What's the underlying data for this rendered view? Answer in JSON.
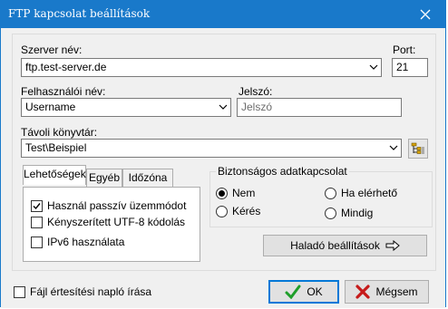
{
  "window": {
    "title": "FTP kapcsolat  beállítások"
  },
  "server": {
    "label": "Szerver név:",
    "value": "ftp.test-server.de"
  },
  "port": {
    "label": "Port:",
    "value": "21"
  },
  "username": {
    "label": "Felhasználói név:",
    "value": "Username"
  },
  "password": {
    "label": "Jelszó:",
    "placeholder": "Jelszó"
  },
  "remote_dir": {
    "label": "Távoli könyvtár:",
    "value": "Test\\Beispiel"
  },
  "tabs": [
    {
      "label": "Lehetőségek"
    },
    {
      "label": "Egyéb"
    },
    {
      "label": "Időzóna"
    }
  ],
  "options": [
    {
      "label": "Használ  passzív üzemmódot",
      "checked": true
    },
    {
      "label": "Kényszerített UTF-8 kódolás",
      "checked": false
    },
    {
      "label": "IPv6 használata",
      "checked": false
    }
  ],
  "security": {
    "title": "Biztonságos adatkapcsolat",
    "options": [
      {
        "label": "Nem",
        "selected": true
      },
      {
        "label": "Ha elérhető",
        "selected": false
      },
      {
        "label": "Kérés",
        "selected": false
      },
      {
        "label": "Mindig",
        "selected": false
      }
    ]
  },
  "advanced_button": {
    "label": "Haladó beállítások"
  },
  "log_checkbox": {
    "label": "Fájl értesítési napló írása",
    "checked": false
  },
  "ok_button": {
    "label": "OK"
  },
  "cancel_button": {
    "label": "Mégsem"
  }
}
